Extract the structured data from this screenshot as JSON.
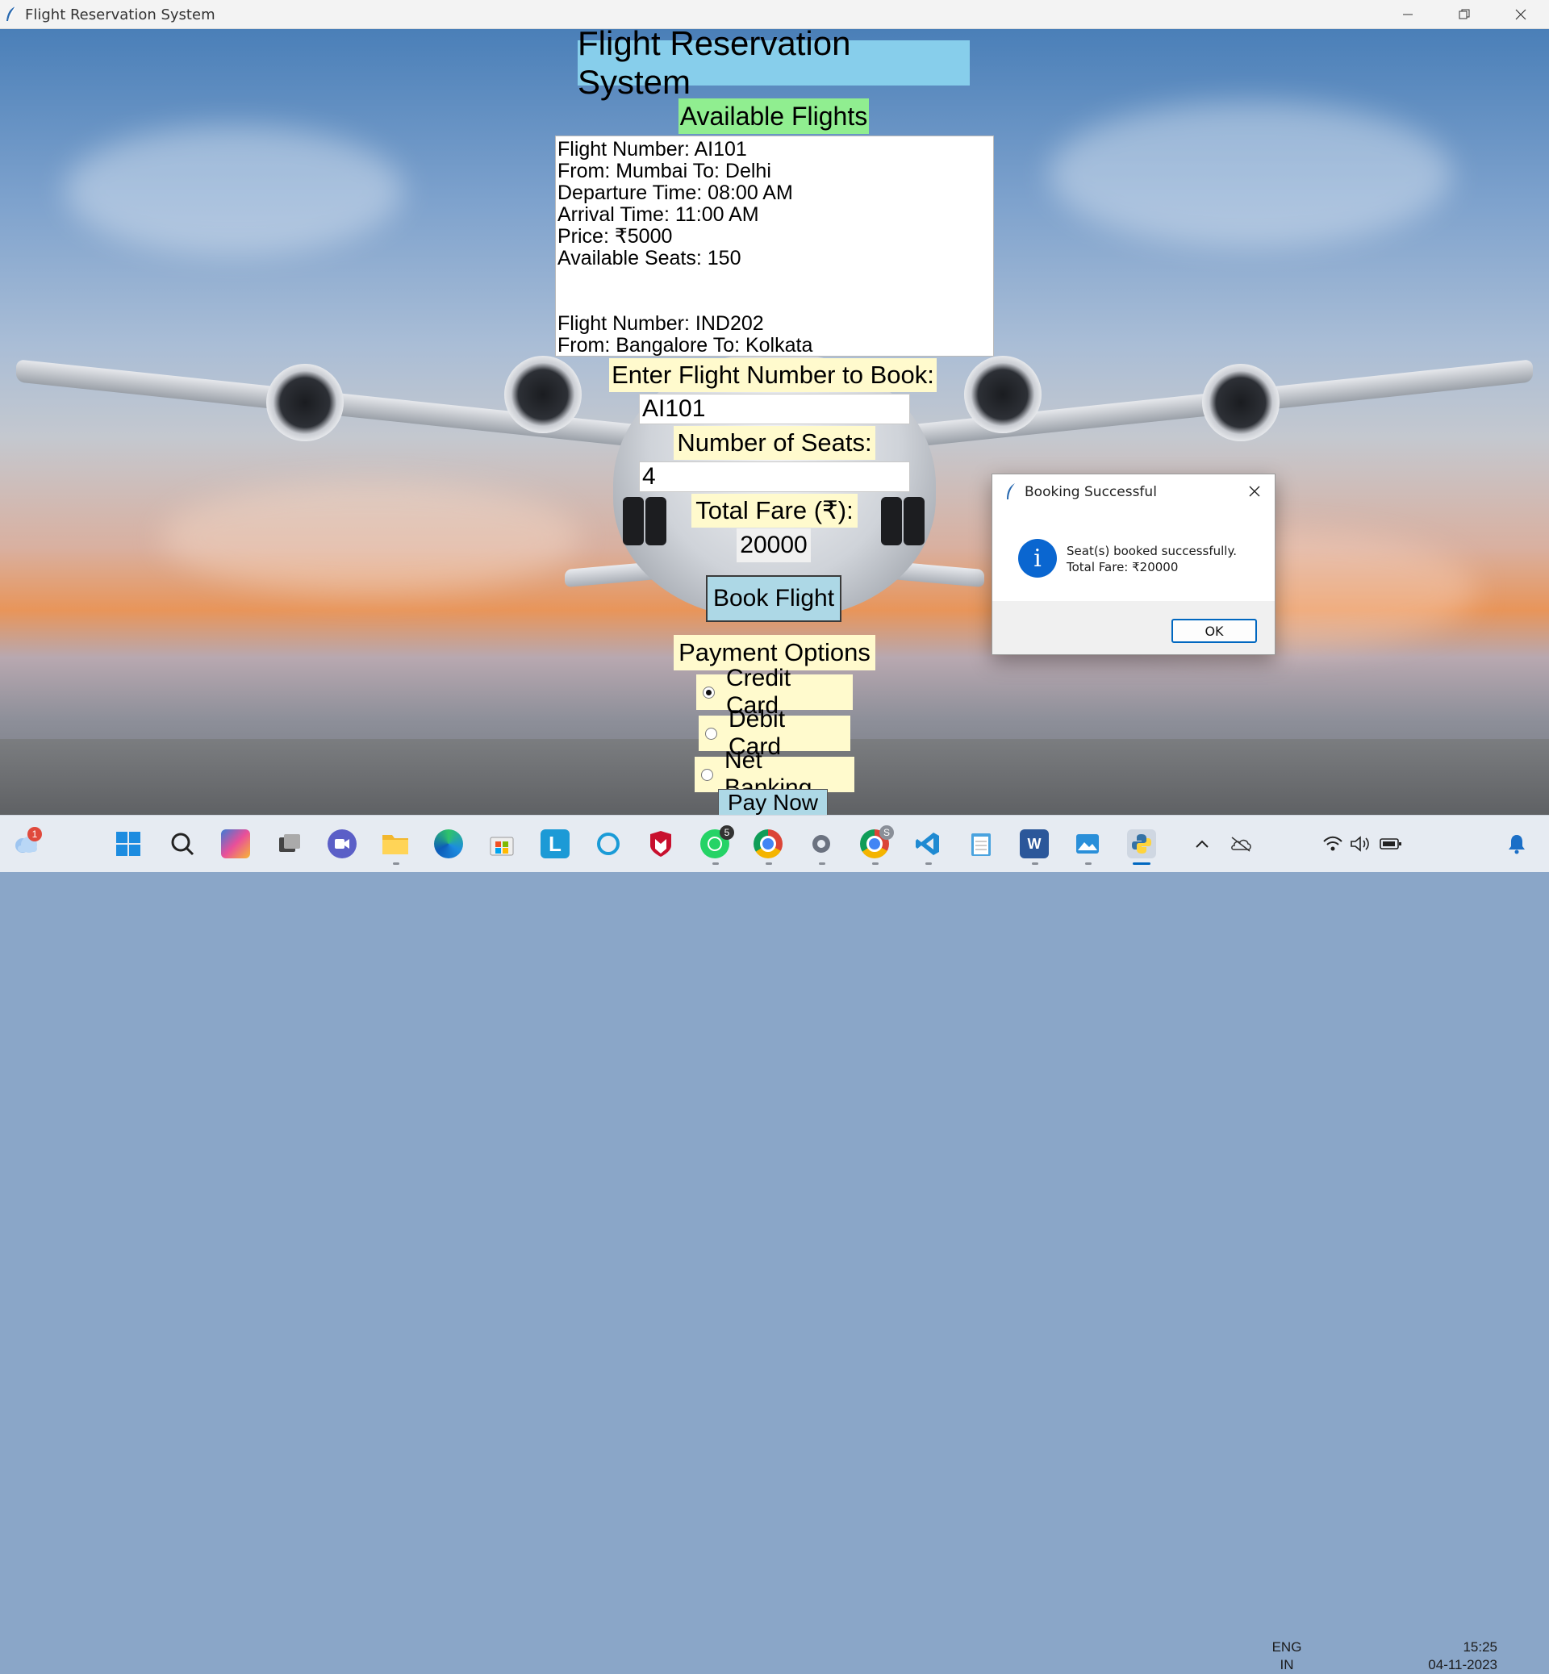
{
  "window": {
    "title": "Flight Reservation System",
    "minimize_icon": "minimize-icon",
    "maximize_icon": "restore-icon",
    "close_icon": "close-icon"
  },
  "app": {
    "heading": "Flight Reservation System",
    "available_flights_label": "Available Flights",
    "flights_text": [
      "Flight Number: AI101",
      "From: Mumbai To: Delhi",
      "Departure Time: 08:00 AM",
      "Arrival Time: 11:00 AM",
      "Price: ₹5000",
      "Available Seats: 150",
      "",
      "",
      "Flight Number: IND202",
      "From: Bangalore To: Kolkata"
    ],
    "flight_number_label": "Enter Flight Number to Book:",
    "flight_number_value": "AI101",
    "seats_label": "Number of Seats:",
    "seats_value": "4",
    "total_fare_label": "Total Fare (₹):",
    "total_fare_value": "20000",
    "book_button": "Book Flight",
    "payment_label": "Payment Options",
    "payment_options": [
      {
        "label": "Credit Card",
        "selected": true
      },
      {
        "label": "Debit Card",
        "selected": false
      },
      {
        "label": "Net Banking",
        "selected": false
      }
    ],
    "pay_button": "Pay Now"
  },
  "dialog": {
    "title": "Booking Successful",
    "icon": "info-icon",
    "message_line1": "Seat(s) booked successfully.",
    "message_line2": "Total Fare: ₹20000",
    "ok_button": "OK"
  },
  "taskbar": {
    "weather_badge": "1",
    "whatsapp_badge": "5",
    "chrome_profile_badge": "S",
    "apps": [
      "weather",
      "start",
      "search",
      "copilot-pre",
      "task-view",
      "teams-chat",
      "file-explorer",
      "edge",
      "microsoft-store",
      "l-app",
      "cortana",
      "mcafee",
      "whatsapp",
      "chrome",
      "settings",
      "chrome-profile",
      "vscode",
      "notepad",
      "word",
      "photos",
      "python"
    ],
    "tray": {
      "language_line1": "ENG",
      "language_line2": "IN",
      "time": "15:25",
      "date": "04-11-2023"
    },
    "colors": {
      "accent": "#0067c0",
      "title_label_bg": "#87ceeb",
      "available_label_bg": "#90ee90",
      "field_label_bg": "#fffacd",
      "button_bg": "#add8e6"
    }
  }
}
